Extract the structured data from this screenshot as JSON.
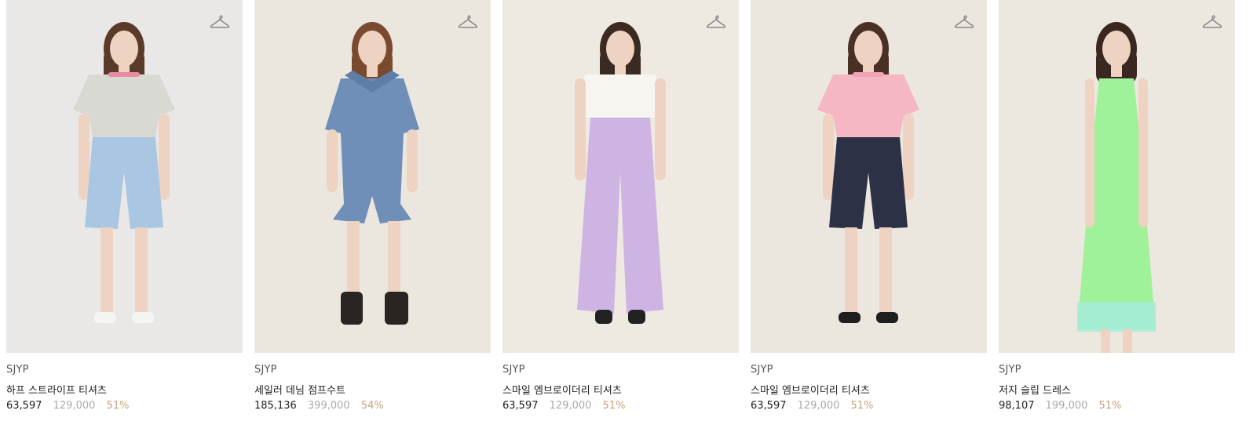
{
  "products": [
    {
      "brand": "SJYP",
      "name": "하프 스트라이프 티셔츠",
      "sale_price": "63,597",
      "original_price": "129,000",
      "discount": "51%",
      "bg": "#e9e8e6",
      "colors": {
        "top": "#d9d9d4",
        "bottom": "#a9c6e3",
        "hair": "#5a3b2a",
        "shoes": "#f4f4f2",
        "trim": "#e98aa6"
      }
    },
    {
      "brand": "SJYP",
      "name": "세일러 데님 점프수트",
      "sale_price": "185,136",
      "original_price": "399,000",
      "discount": "54%",
      "bg": "#ebe7df",
      "colors": {
        "top": "#6f8fb8",
        "bottom": "#6f8fb8",
        "hair": "#7a4a2e",
        "shoes": "#2a2522",
        "trim": "#5e7ea8"
      }
    },
    {
      "brand": "SJYP",
      "name": "스마일 엠브로이더리 티셔츠",
      "sale_price": "63,597",
      "original_price": "129,000",
      "discount": "51%",
      "bg": "#eeeae2",
      "colors": {
        "top": "#f7f5f0",
        "bottom": "#cdb4e3",
        "hair": "#3b2a22",
        "shoes": "#222222",
        "trim": "#e8e2ee"
      }
    },
    {
      "brand": "SJYP",
      "name": "스마일 엠브로이더리 티셔츠",
      "sale_price": "63,597",
      "original_price": "129,000",
      "discount": "51%",
      "bg": "#ebe7df",
      "colors": {
        "top": "#f6b7c4",
        "bottom": "#2c3145",
        "hair": "#4a3024",
        "shoes": "#1e1e1e",
        "trim": "#f0a3b5"
      }
    },
    {
      "brand": "SJYP",
      "name": "저지 슬립 드레스",
      "sale_price": "98,107",
      "original_price": "199,000",
      "discount": "51%",
      "bg": "#ece7df",
      "colors": {
        "top": "#9ff29a",
        "bottom": "#9ff29a",
        "hair": "#3a2820",
        "shoes": "#9fe7d9",
        "trim": "#a6ecd9"
      }
    }
  ],
  "icons": {
    "wishlist": "hanger-icon"
  }
}
